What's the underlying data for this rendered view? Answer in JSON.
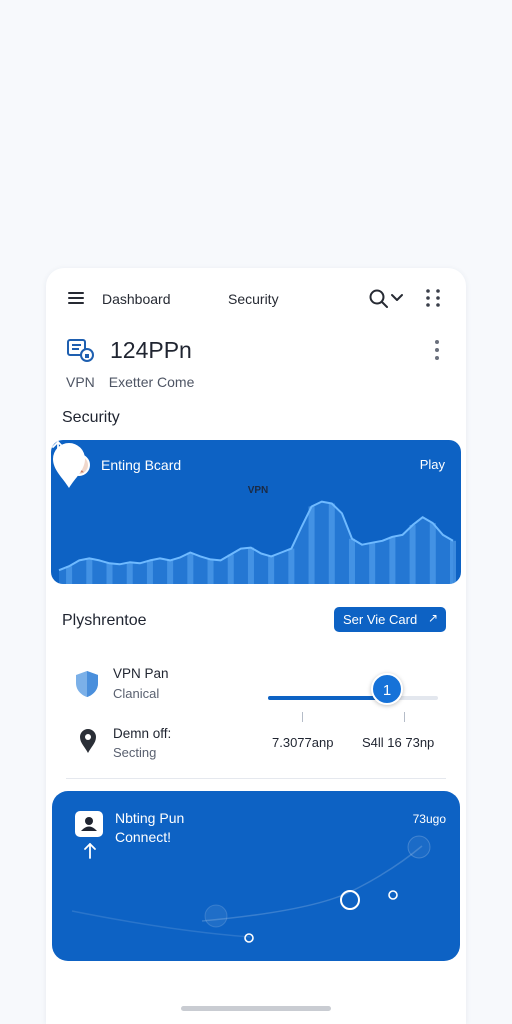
{
  "colors": {
    "accent": "#0d62c4",
    "background": "#f7f9fc",
    "card": "#ffffff",
    "text": "#1f2430",
    "muted": "#5a6170"
  },
  "topbar": {
    "menu_icon": "hamburger-menu-icon",
    "tabs": [
      {
        "label": "Dashboard"
      },
      {
        "label": "Security"
      }
    ],
    "search_icon": "search-icon",
    "dropdown_icon": "chevron-down-icon",
    "more_icon": "grid-dots-icon"
  },
  "account": {
    "icon": "vpn-account-icon",
    "title": "124PPn",
    "sub_left": "VPN",
    "sub_right": "Exetter Come",
    "more_icon": "vertical-dots-icon"
  },
  "security": {
    "section_title": "Security",
    "card": {
      "title": "Enting Bcard",
      "action": "Play",
      "pin_label": "VPN",
      "avatar_icon": "user-avatar-icon",
      "trend_icon": "arrow-up-icon"
    }
  },
  "plan": {
    "title": "Plyshrentoe",
    "button_label": "Ser Vie Card",
    "button_icon": "expand-arrow-icon",
    "rows": [
      {
        "icon": "shield-icon",
        "title": "VPN Pan",
        "sub": "Clanical"
      },
      {
        "icon": "location-pin-icon",
        "title": "Demn off:",
        "sub": "Secting",
        "value_left": "7.3077anp",
        "value_right": "S4ll 16 73np"
      }
    ],
    "slider": {
      "value_label": "1",
      "level": 0.7
    }
  },
  "connect": {
    "title": "Nbting Pun",
    "sub": "Connect!",
    "badge": "73ugo",
    "avatar_icon": "user-square-icon",
    "trend_icon": "arrow-up-icon"
  },
  "chart_data": {
    "type": "area",
    "title": "",
    "xlabel": "",
    "ylabel": "",
    "x": [
      0,
      1,
      2,
      3,
      4,
      5,
      6,
      7,
      8,
      9,
      10,
      11,
      12,
      13,
      14,
      15,
      16,
      17,
      18,
      19,
      20,
      21,
      22,
      23,
      24,
      25,
      26,
      27,
      28,
      29,
      30,
      31,
      32,
      33,
      34,
      35,
      36,
      37,
      38,
      39
    ],
    "values": [
      8,
      12,
      18,
      20,
      18,
      15,
      14,
      16,
      15,
      18,
      20,
      18,
      21,
      26,
      22,
      19,
      18,
      24,
      30,
      31,
      25,
      22,
      26,
      30,
      52,
      73,
      78,
      76,
      66,
      40,
      34,
      36,
      38,
      42,
      44,
      54,
      62,
      56,
      44,
      38
    ],
    "ylim": [
      0,
      100
    ],
    "grid": false,
    "bars": true
  }
}
